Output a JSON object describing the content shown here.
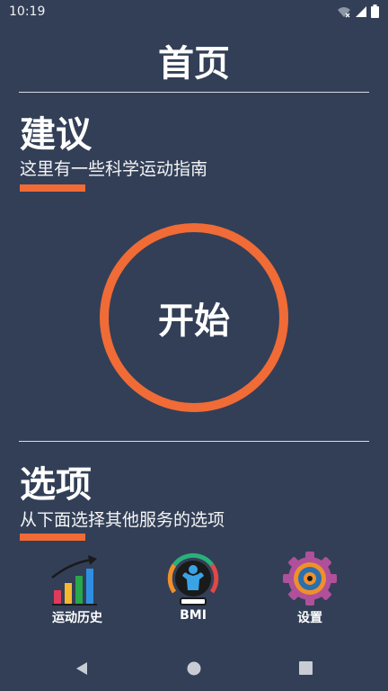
{
  "status": {
    "time": "10:19",
    "icons": [
      "wifi-off-icon",
      "signal-icon",
      "battery-icon"
    ]
  },
  "header": {
    "title": "首页"
  },
  "advice": {
    "title": "建议",
    "subtitle": "这里有一些科学运动指南"
  },
  "start": {
    "label": "开始"
  },
  "options": {
    "title": "选项",
    "subtitle": "从下面选择其他服务的选项",
    "items": [
      {
        "label": "运动历史",
        "icon": "bar-chart-growth-icon"
      },
      {
        "label": "BMI",
        "icon": "bmi-gauge-icon"
      },
      {
        "label": "设置",
        "icon": "gear-icon"
      }
    ]
  },
  "nav": {
    "icons": [
      "back-icon",
      "home-icon",
      "recents-icon"
    ]
  },
  "colors": {
    "background": "#323f57",
    "accent": "#f06b36",
    "text": "#ffffff"
  }
}
